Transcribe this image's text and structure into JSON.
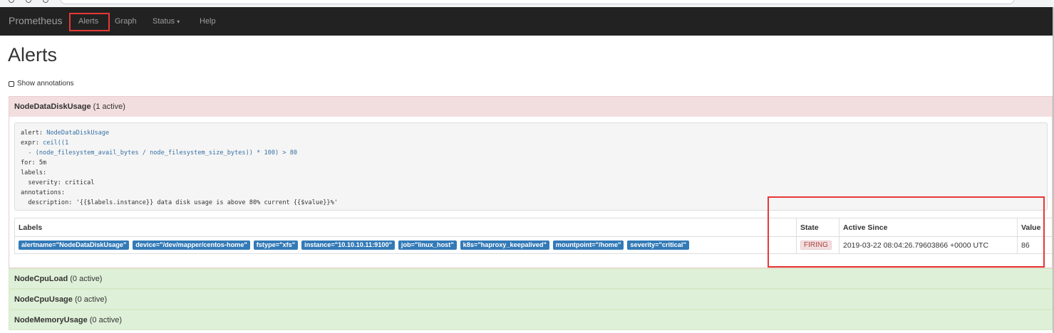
{
  "navbar": {
    "brand": "Prometheus",
    "items": [
      {
        "label": "Alerts"
      },
      {
        "label": "Graph"
      },
      {
        "label": "Status"
      },
      {
        "label": "Help"
      }
    ],
    "status_caret": "▾"
  },
  "page": {
    "title": "Alerts",
    "show_annotations_label": "Show annotations"
  },
  "groups": [
    {
      "name": "NodeDataDiskUsage",
      "count": "(1 active)",
      "state": "firing",
      "rule": {
        "alert_key": "alert:",
        "alert_val": "NodeDataDiskUsage",
        "expr_key": "expr:",
        "expr_line1": "ceil((1",
        "expr_line2": "  - (node_filesystem_avail_bytes / node_filesystem_size_bytes)) * 100) > 80",
        "for_line": "for: 5m",
        "labels_line": "labels:",
        "severity_line": "  severity: critical",
        "annotations_line": "annotations:",
        "description_line": "  description: '{{$labels.instance}} data disk usage is above 80% current {{$value}}%'"
      },
      "table": {
        "headers": {
          "labels": "Labels",
          "state": "State",
          "active_since": "Active Since",
          "value": "Value"
        },
        "rows": [
          {
            "labels": [
              "alertname=\"NodeDataDiskUsage\"",
              "device=\"/dev/mapper/centos-home\"",
              "fstype=\"xfs\"",
              "instance=\"10.10.10.11:9100\"",
              "job=\"linux_host\"",
              "k8s=\"haproxy_keepalived\"",
              "mountpoint=\"/home\"",
              "severity=\"critical\""
            ],
            "state": "FIRING",
            "active_since": "2019-03-22 08:04:26.79603866 +0000 UTC",
            "value": "86"
          }
        ]
      }
    },
    {
      "name": "NodeCpuLoad",
      "count": "(0 active)",
      "state": "inactive"
    },
    {
      "name": "NodeCpuUsage",
      "count": "(0 active)",
      "state": "inactive"
    },
    {
      "name": "NodeMemoryUsage",
      "count": "(0 active)",
      "state": "inactive"
    }
  ],
  "colors": {
    "navbar_bg": "#222222",
    "firing_bg": "#f2dede",
    "inactive_bg": "#dff0d8",
    "label_bg": "#337ab7",
    "highlight": "#e53935"
  }
}
